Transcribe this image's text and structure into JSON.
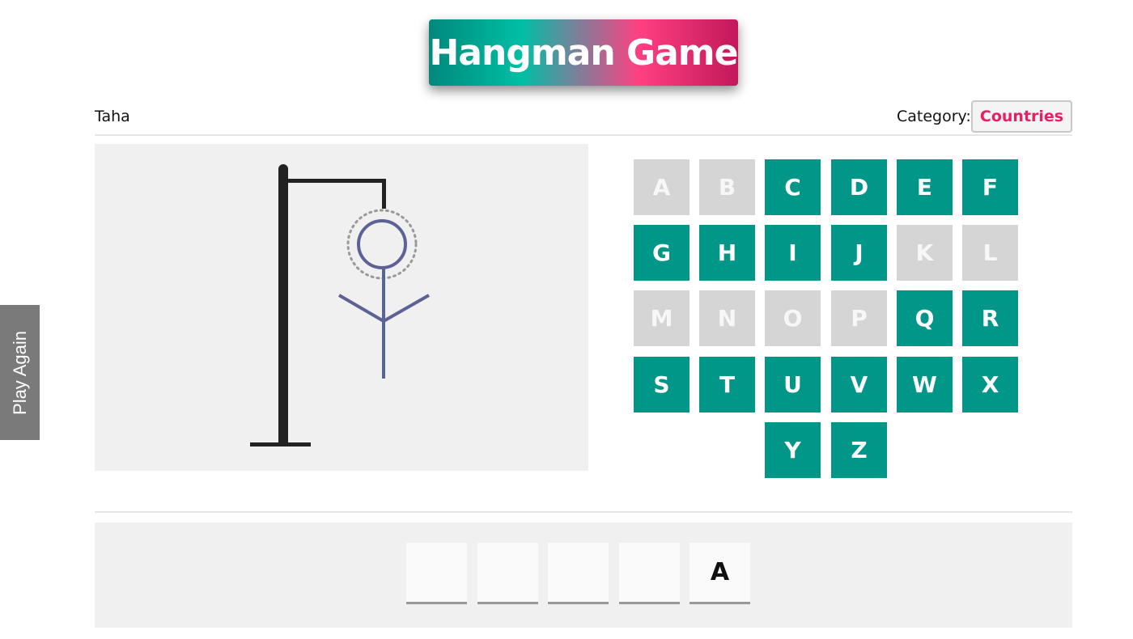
{
  "title": "Hangman Game",
  "player": {
    "name": "Taha"
  },
  "category": {
    "label": "Category:",
    "value": "Countries"
  },
  "play_again_label": "Play Again",
  "letters": [
    {
      "letter": "A",
      "used": true
    },
    {
      "letter": "B",
      "used": true
    },
    {
      "letter": "C",
      "used": false
    },
    {
      "letter": "D",
      "used": false
    },
    {
      "letter": "E",
      "used": false
    },
    {
      "letter": "F",
      "used": false
    },
    {
      "letter": "G",
      "used": false
    },
    {
      "letter": "H",
      "used": false
    },
    {
      "letter": "I",
      "used": false
    },
    {
      "letter": "J",
      "used": false
    },
    {
      "letter": "K",
      "used": true
    },
    {
      "letter": "L",
      "used": true
    },
    {
      "letter": "M",
      "used": true
    },
    {
      "letter": "N",
      "used": true
    },
    {
      "letter": "O",
      "used": true
    },
    {
      "letter": "P",
      "used": true
    },
    {
      "letter": "Q",
      "used": false
    },
    {
      "letter": "R",
      "used": false
    },
    {
      "letter": "S",
      "used": false
    },
    {
      "letter": "T",
      "used": false
    },
    {
      "letter": "U",
      "used": false
    },
    {
      "letter": "V",
      "used": false
    },
    {
      "letter": "W",
      "used": false
    },
    {
      "letter": "X",
      "used": false
    },
    {
      "letter": "Y",
      "used": false
    },
    {
      "letter": "Z",
      "used": false
    }
  ],
  "word_slots": [
    "",
    "",
    "",
    "",
    "A"
  ],
  "colors": {
    "available": "#009688",
    "used": "#d5d5d5",
    "category_accent": "#e91e63",
    "figure": "#5c6394"
  }
}
